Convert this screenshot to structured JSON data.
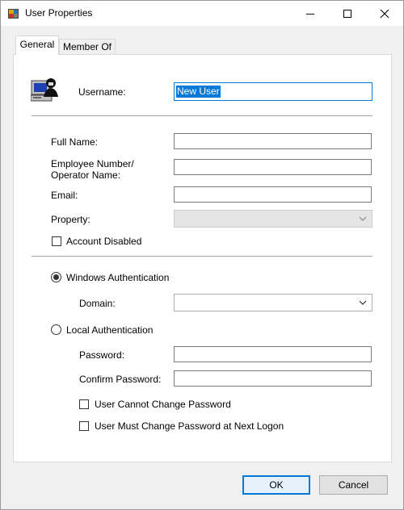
{
  "window": {
    "title": "User Properties"
  },
  "tabs": [
    {
      "label": "General",
      "active": true
    },
    {
      "label": "Member Of",
      "active": false
    }
  ],
  "general": {
    "username_label": "Username:",
    "username_value": "New User",
    "full_name_label": "Full Name:",
    "full_name_value": "",
    "employee_label": "Employee Number/\nOperator Name:",
    "employee_value": "",
    "email_label": "Email:",
    "email_value": "",
    "property_label": "Property:",
    "property_value": "",
    "account_disabled_label": "Account Disabled",
    "account_disabled_checked": false,
    "windows_auth_label": "Windows Authentication",
    "windows_auth_selected": true,
    "domain_label": "Domain:",
    "domain_value": "",
    "local_auth_label": "Local Authentication",
    "local_auth_selected": false,
    "password_label": "Password:",
    "confirm_password_label": "Confirm Password:",
    "cannot_change_label": "User Cannot Change Password",
    "cannot_change_checked": false,
    "must_change_label": "User Must Change Password at Next Logon",
    "must_change_checked": false
  },
  "buttons": {
    "ok": "OK",
    "cancel": "Cancel"
  },
  "icons": {
    "app": "user-properties-icon",
    "user": "user-computer-icon",
    "minimize": "minimize-icon",
    "maximize": "maximize-icon",
    "close": "close-icon"
  },
  "colors": {
    "accent": "#0078d7",
    "window_bg": "#f0f0f0",
    "panel_bg": "#ffffff"
  }
}
